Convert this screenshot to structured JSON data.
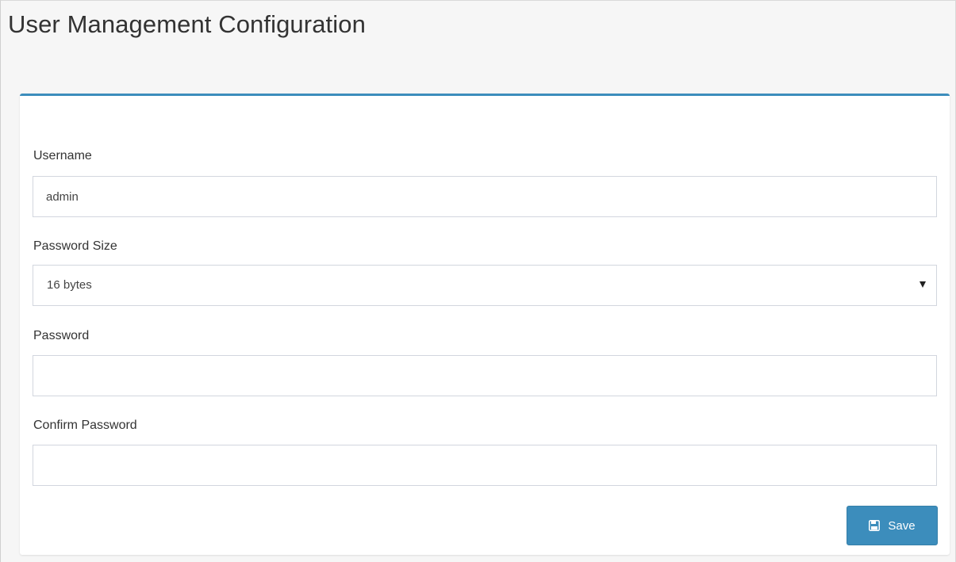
{
  "page": {
    "title": "User Management Configuration"
  },
  "form": {
    "username_label": "Username",
    "username_value": "admin",
    "password_size_label": "Password Size",
    "password_size_value": "16 bytes",
    "password_label": "Password",
    "password_value": "",
    "confirm_password_label": "Confirm Password",
    "confirm_password_value": ""
  },
  "actions": {
    "save_label": "Save",
    "save_icon": "floppy-disk-icon"
  },
  "colors": {
    "accent": "#3c8dbc",
    "page_background": "#f6f6f6",
    "panel_background": "#ffffff",
    "input_border": "#d2d6de"
  }
}
